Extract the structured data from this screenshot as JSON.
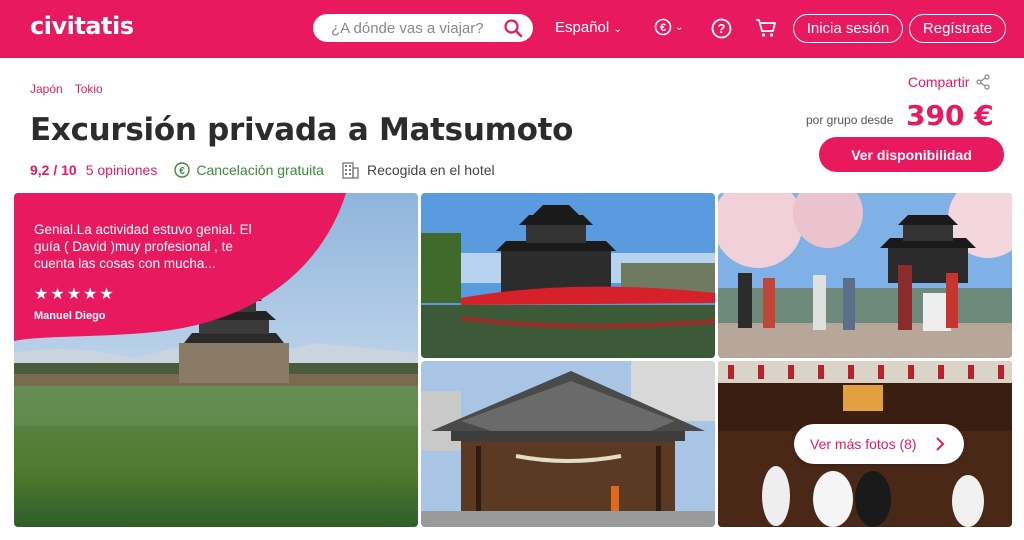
{
  "header": {
    "logo": "civitatis",
    "search_placeholder": "¿A dónde vas a viajar?",
    "language": "Español",
    "currency_symbol": "€",
    "login": "Inicia sesión",
    "register": "Regístrate",
    "brand_color": "#e8195f"
  },
  "breadcrumb": [
    "Japón",
    "Tokio"
  ],
  "title": "Excursión privada a Matsumoto",
  "rating": "9,2 / 10",
  "opinions": "5 opiniones",
  "cancellation": "Cancelación gratuita",
  "pickup": "Recogida en el hotel",
  "share": "Compartir",
  "price_label": "por grupo desde",
  "price": "390 €",
  "availability_button": "Ver disponibilidad",
  "review": {
    "text": "Genial.La actividad estuvo genial. El guía ( David )muy profesional , te cuenta las cosas con mucha...",
    "stars": "★★★★★",
    "author": "Manuel Diego"
  },
  "more_photos": "Ver más fotos (8)",
  "icons": {
    "search": "search-icon",
    "help": "help-icon",
    "cart": "cart-icon",
    "share": "share-icon",
    "euro": "euro-icon",
    "building": "building-icon",
    "chevron": "chevron-right-icon"
  }
}
